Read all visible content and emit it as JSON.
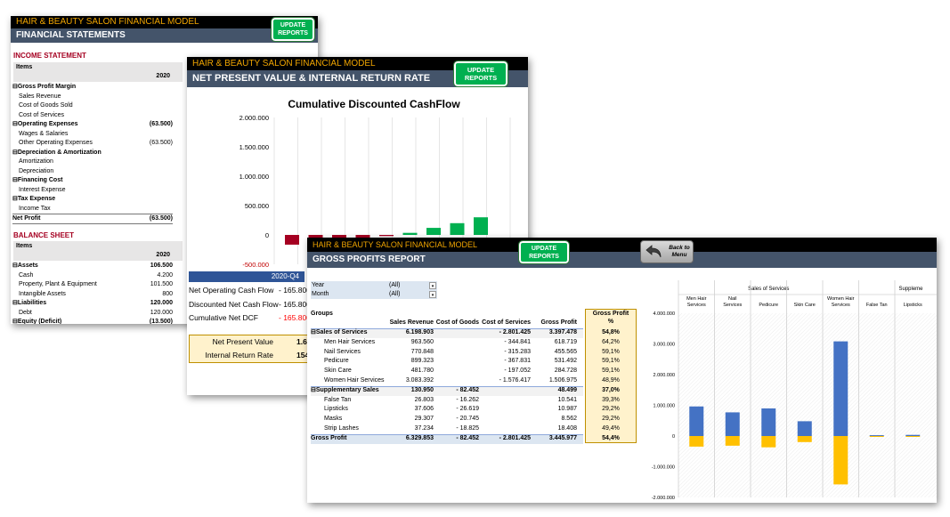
{
  "fs": {
    "model_title": "HAIR & BEAUTY SALON FINANCIAL MODEL",
    "sheet_title": "FINANCIAL STATEMENTS",
    "update_btn": [
      "UPDATE",
      "REPORTS"
    ],
    "income_title": "INCOME STATEMENT",
    "items_label": "Items",
    "year": "2020",
    "income_rows": [
      {
        "label": "⊟Gross Profit Margin",
        "value": "",
        "bold": true
      },
      {
        "label": "Sales Revenue",
        "value": "",
        "bold": false
      },
      {
        "label": "Cost of Goods Sold",
        "value": "",
        "bold": false
      },
      {
        "label": "Cost of Services",
        "value": "",
        "bold": false
      },
      {
        "label": "⊟Operating Expenses",
        "value": "(63.500)",
        "bold": true
      },
      {
        "label": "Wages & Salaries",
        "value": "",
        "bold": false
      },
      {
        "label": "Other Operating Expenses",
        "value": "(63.500)",
        "bold": false
      },
      {
        "label": "⊟Depreciation & Amortization",
        "value": "",
        "bold": true
      },
      {
        "label": "Amortization",
        "value": "",
        "bold": false
      },
      {
        "label": "Depreciation",
        "value": "",
        "bold": false
      },
      {
        "label": "⊟Financing Cost",
        "value": "",
        "bold": true
      },
      {
        "label": "Interest Expense",
        "value": "",
        "bold": false
      },
      {
        "label": "⊟Tax Expense",
        "value": "",
        "bold": true
      },
      {
        "label": "Income Tax",
        "value": "",
        "bold": false
      }
    ],
    "net_profit": {
      "label": "Net Profit",
      "value": "(63.500)"
    },
    "balance_title": "BALANCE SHEET",
    "balance_rows": [
      {
        "label": "⊟Assets",
        "value": "106.500",
        "bold": true
      },
      {
        "label": "Cash",
        "value": "4.200",
        "bold": false
      },
      {
        "label": "Property, Plant & Equipment",
        "value": "101.500",
        "bold": false
      },
      {
        "label": "Intangible Assets",
        "value": "800",
        "bold": false
      },
      {
        "label": "⊟Liabilities",
        "value": "120.000",
        "bold": true
      },
      {
        "label": "Debt",
        "value": "120.000",
        "bold": false
      },
      {
        "label": "⊟Equity (Deficit)",
        "value": "(13.500)",
        "bold": true
      }
    ]
  },
  "npv": {
    "model_title": "HAIR & BEAUTY SALON FINANCIAL MODEL",
    "sheet_title": "NET PRESENT VALUE & INTERNAL RETURN RATE",
    "update_btn": [
      "UPDATE",
      "REPORTS"
    ],
    "period_label": "2020-Q4",
    "rows": [
      {
        "label": "Net Operating Cash Flow",
        "value": "- 165.800",
        "red": false
      },
      {
        "label": "Discounted Net Cash Flow",
        "value": "- 165.800",
        "red": false
      },
      {
        "label": "Cumulative Net DCF",
        "value": "- 165.800",
        "red": true
      }
    ],
    "results": [
      {
        "label": "Net Present Value",
        "value": "1.68"
      },
      {
        "label": "Internal Return Rate",
        "value": "154"
      }
    ]
  },
  "chart_data": [
    {
      "type": "bar",
      "title": "Cumulative Discounted CashFlow",
      "ylim": [
        -500000,
        2000000
      ],
      "yticks": [
        "2.000.000",
        "1.500.000",
        "1.000.000",
        "500.000",
        "0",
        "-500.000"
      ],
      "values": [
        -165800,
        -120000,
        -90000,
        -60000,
        -20000,
        35000,
        120000,
        200000,
        300000
      ],
      "colors": {
        "positive": "#00b050",
        "negative": "#a50021"
      }
    },
    {
      "type": "bar",
      "title": "",
      "ylim": [
        -2000000,
        4000000
      ],
      "yticks": [
        "4.000.000",
        "3.000.000",
        "2.000.000",
        "1.000.000",
        "0",
        "-1.000.000",
        "-2.000.000"
      ],
      "group_labels": [
        "Sales of Services",
        "Suppleme"
      ],
      "categories": [
        "Men Hair Services",
        "Nail Services",
        "Pedicure",
        "Skin Care",
        "Women Hair Services",
        "False Tan",
        "Lipsticks"
      ],
      "series": [
        {
          "values": [
            963560,
            770848,
            899323,
            481780,
            3083392,
            26803,
            37606
          ],
          "color": "#4472c4"
        },
        {
          "values": [
            -344841,
            -315283,
            -367831,
            -197052,
            -1576417,
            -16262,
            -26619
          ],
          "color": "#ffc000"
        }
      ]
    }
  ],
  "gp": {
    "model_title": "HAIR & BEAUTY SALON FINANCIAL MODEL",
    "sheet_title": "GROSS PROFITS REPORT",
    "update_btn": [
      "UPDATE",
      "REPORTS"
    ],
    "back_btn": [
      "Back to",
      "Menu"
    ],
    "filters": [
      {
        "label": "Year",
        "value": "(All)"
      },
      {
        "label": "Month",
        "value": "(All)"
      }
    ],
    "groups_label": "Groups",
    "columns": [
      "Sales Revenue",
      "Cost of Goods",
      "Cost of Services",
      "Gross Profit"
    ],
    "gp_pct_header": [
      "Gross Profit",
      "%"
    ],
    "rows": [
      {
        "label": "⊟Sales of Services",
        "sales": "6.198.903",
        "cogs": "",
        "cos": "- 2.801.425",
        "gp": "3.397.478",
        "pct": "54,8%",
        "bold": true
      },
      {
        "label": "Men Hair Services",
        "sales": "963.560",
        "cogs": "",
        "cos": "- 344.841",
        "gp": "618.719",
        "pct": "64,2%",
        "bold": false
      },
      {
        "label": "Nail Services",
        "sales": "770.848",
        "cogs": "",
        "cos": "- 315.283",
        "gp": "455.565",
        "pct": "59,1%",
        "bold": false
      },
      {
        "label": "Pedicure",
        "sales": "899.323",
        "cogs": "",
        "cos": "- 367.831",
        "gp": "531.492",
        "pct": "59,1%",
        "bold": false
      },
      {
        "label": "Skin Care",
        "sales": "481.780",
        "cogs": "",
        "cos": "- 197.052",
        "gp": "284.728",
        "pct": "59,1%",
        "bold": false
      },
      {
        "label": "Women Hair Services",
        "sales": "3.083.392",
        "cogs": "",
        "cos": "- 1.576.417",
        "gp": "1.506.975",
        "pct": "48,9%",
        "bold": false
      },
      {
        "label": "⊟Supplementary Sales",
        "sales": "130.950",
        "cogs": "- 82.452",
        "cos": "",
        "gp": "48.499",
        "pct": "37,0%",
        "bold": true
      },
      {
        "label": "False Tan",
        "sales": "26.803",
        "cogs": "- 16.262",
        "cos": "",
        "gp": "10.541",
        "pct": "39,3%",
        "bold": false
      },
      {
        "label": "Lipsticks",
        "sales": "37.606",
        "cogs": "- 26.619",
        "cos": "",
        "gp": "10.987",
        "pct": "29,2%",
        "bold": false
      },
      {
        "label": "Masks",
        "sales": "29.307",
        "cogs": "- 20.745",
        "cos": "",
        "gp": "8.562",
        "pct": "29,2%",
        "bold": false
      },
      {
        "label": "Strip Lashes",
        "sales": "37.234",
        "cogs": "- 18.825",
        "cos": "",
        "gp": "18.408",
        "pct": "49,4%",
        "bold": false
      }
    ],
    "total": {
      "label": "Gross Profit",
      "sales": "6.329.853",
      "cogs": "- 82.452",
      "cos": "- 2.801.425",
      "gp": "3.445.977",
      "pct": "54,4%"
    }
  }
}
